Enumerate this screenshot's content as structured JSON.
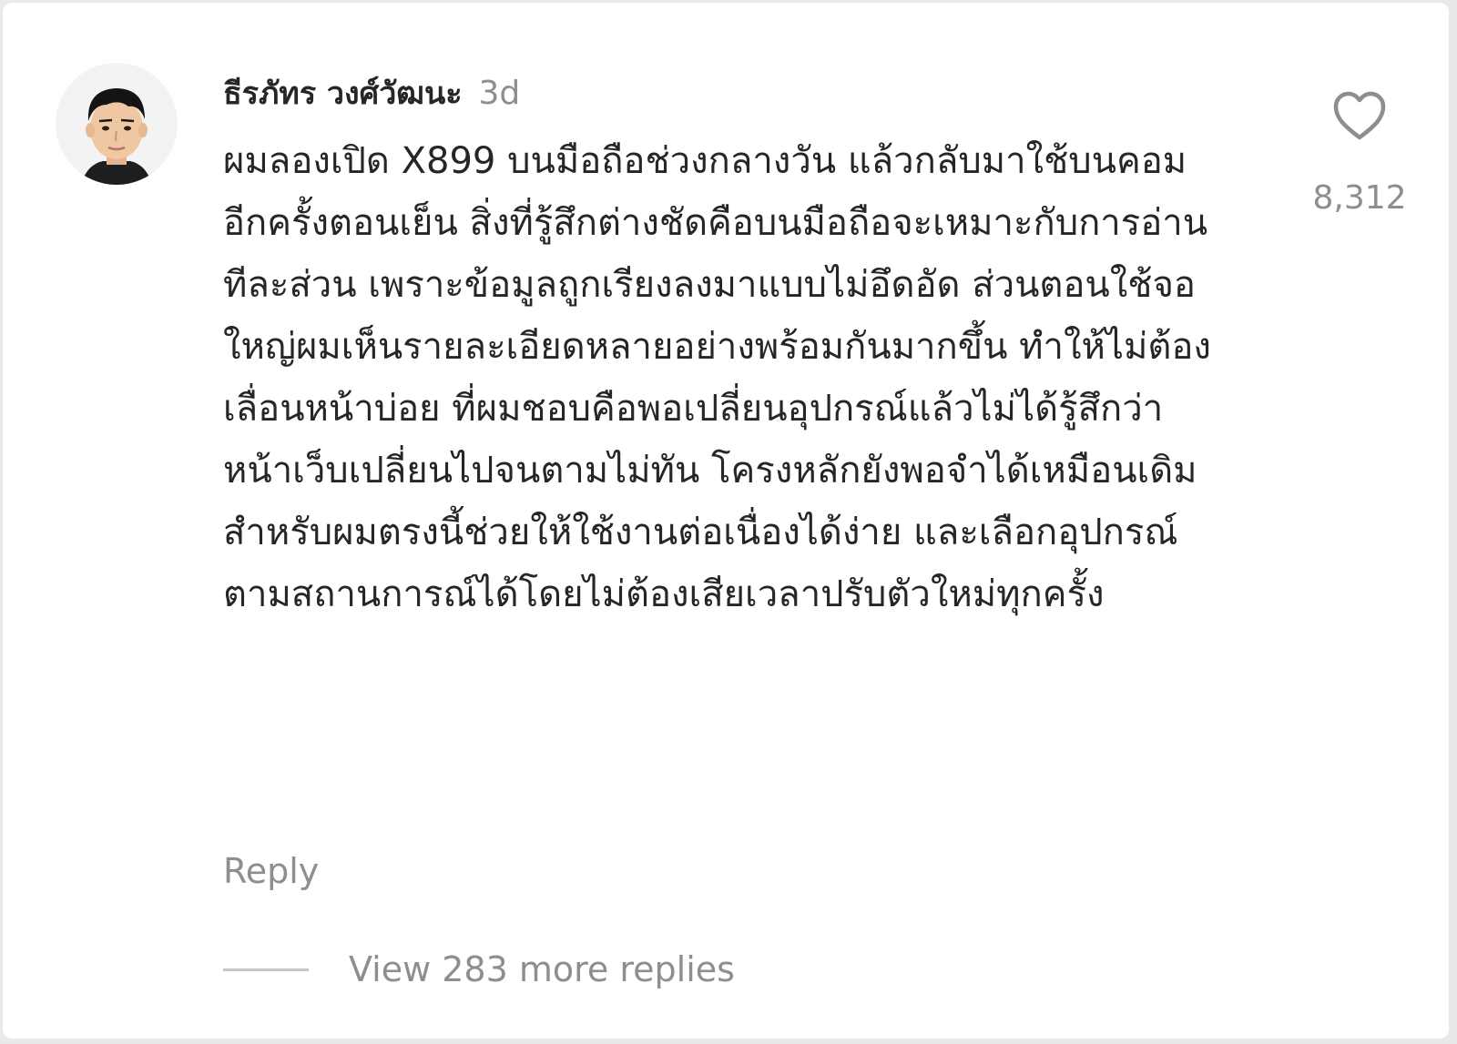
{
  "comment": {
    "username": "ธีรภัทร วงศ์วัฒนะ",
    "time": "3d",
    "text": "ผมลองเปิด X899 บนมือถือช่วงกลางวัน แล้วกลับมาใช้บนคอมอีกครั้งตอนเย็น สิ่งที่รู้สึกต่างชัดคือบนมือถือจะเหมาะกับการอ่านทีละส่วน เพราะข้อมูลถูกเรียงลงมาแบบไม่อึดอัด ส่วนตอนใช้จอใหญ่ผมเห็นรายละเอียดหลายอย่างพร้อมกันมากขึ้น ทำให้ไม่ต้องเลื่อนหน้าบ่อย ที่ผมชอบคือพอเปลี่ยนอุปกรณ์แล้วไม่ได้รู้สึกว่าหน้าเว็บเปลี่ยนไปจนตามไม่ทัน โครงหลักยังพอจำได้เหมือนเดิม สำหรับผมตรงนี้ช่วยให้ใช้งานต่อเนื่องได้ง่าย และเลือกอุปกรณ์ตามสถานการณ์ได้โดยไม่ต้องเสียเวลาปรับตัวใหม่ทุกครั้ง",
    "like_count": "8,312",
    "reply_label": "Reply",
    "view_replies_label": "View 283 more replies"
  },
  "icons": {
    "avatar": "profile-photo",
    "like": "heart-outline-icon"
  },
  "colors": {
    "text_primary": "#262626",
    "text_secondary": "#8e8e8e",
    "background": "#ffffff"
  }
}
